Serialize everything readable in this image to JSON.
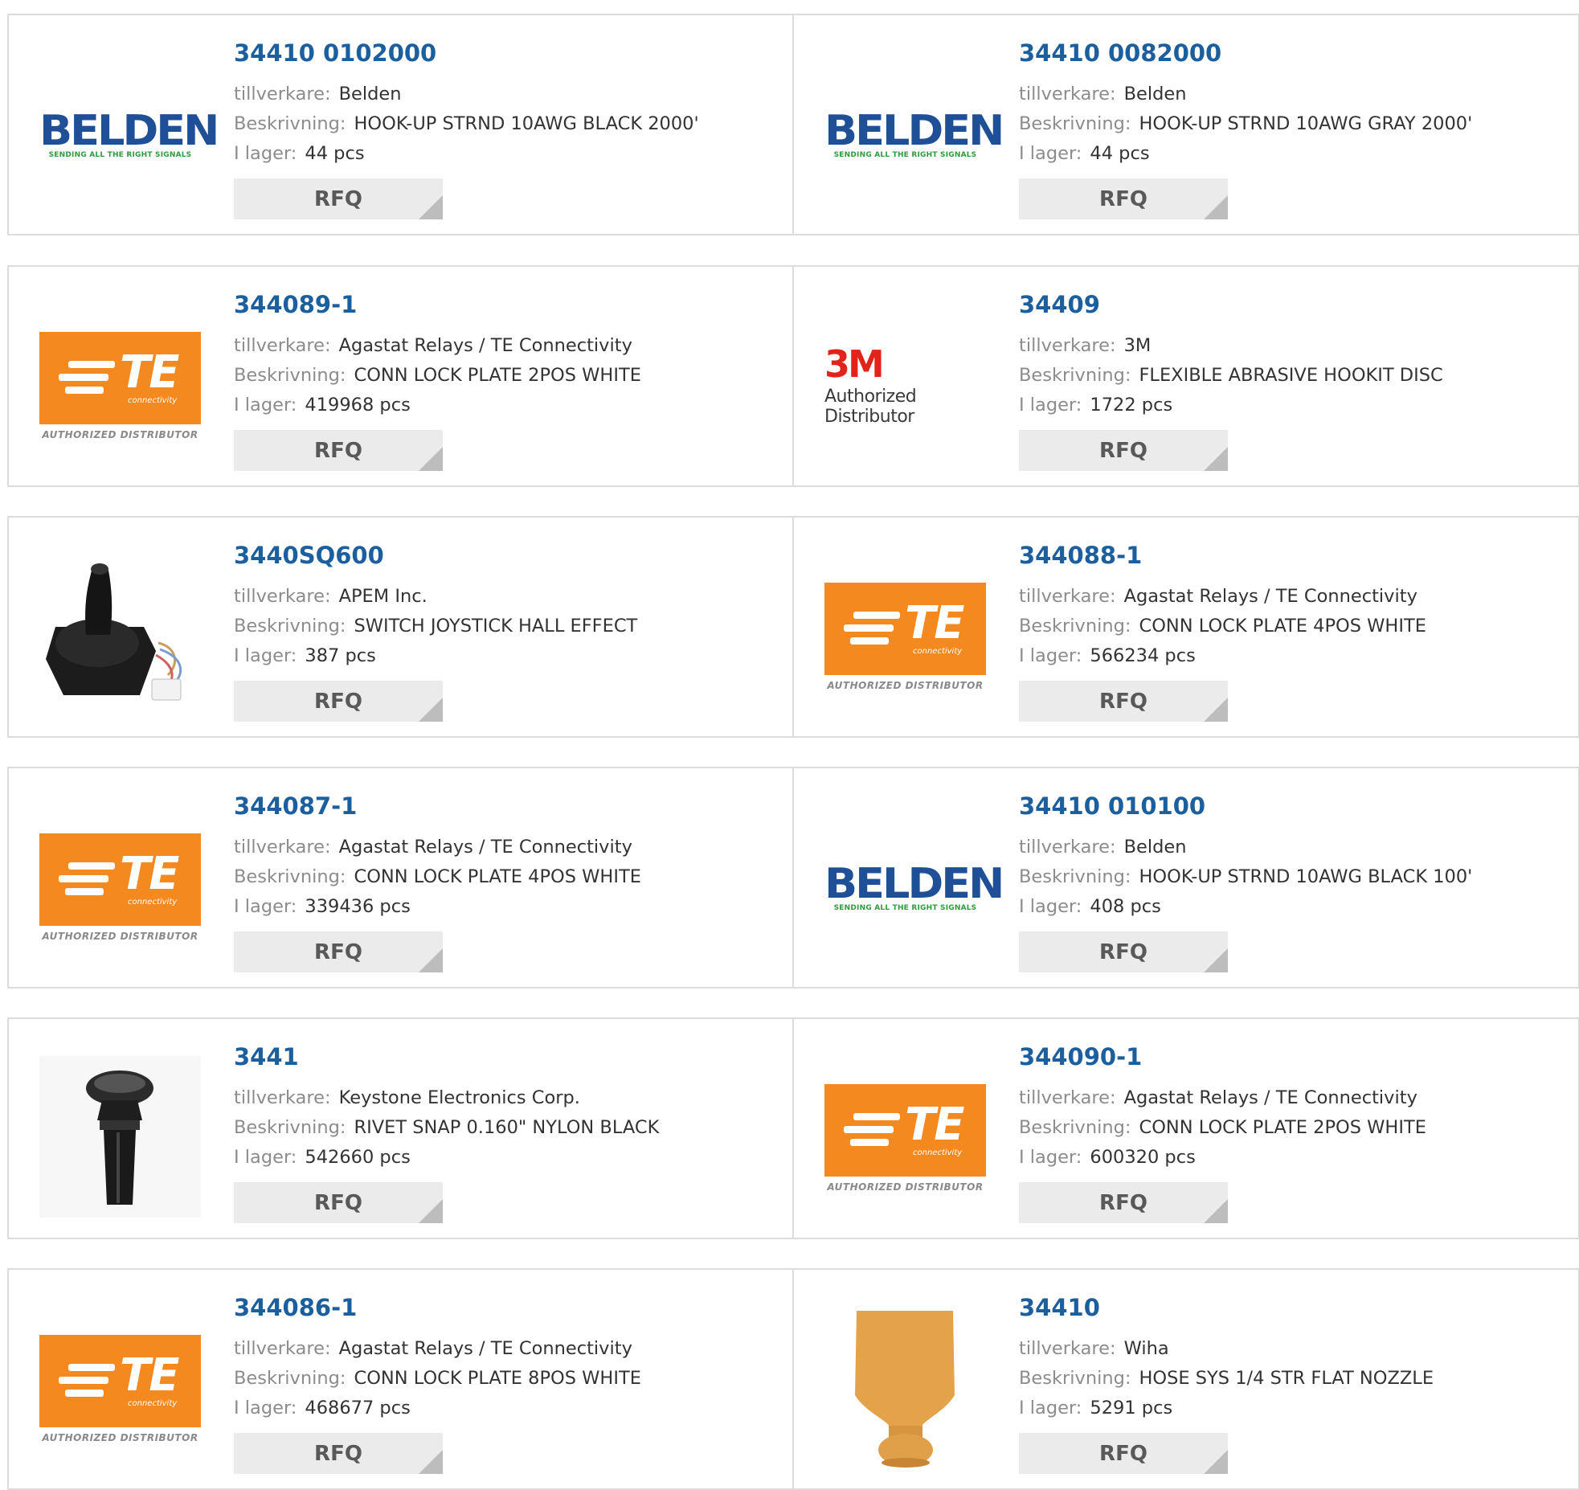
{
  "labels": {
    "manufacturer": "tillverkare:",
    "description": "Beskrivning:",
    "stock": "I lager:",
    "rfq": "RFQ"
  },
  "logo_text": {
    "belden_word": "BELDEN",
    "belden_tag": "SENDING ALL THE RIGHT SIGNALS",
    "te_letters": "TE",
    "te_sub": "connectivity",
    "te_auth": "AUTHORIZED DISTRIBUTOR",
    "mmm_logo": "3M",
    "mmm_auth": "Authorized Distributor"
  },
  "products": [
    {
      "part": "34410 0102000",
      "manufacturer": "Belden",
      "description": "HOOK-UP STRND 10AWG BLACK 2000'",
      "stock": "44 pcs",
      "image": "belden-logo"
    },
    {
      "part": "34410 0082000",
      "manufacturer": "Belden",
      "description": "HOOK-UP STRND 10AWG GRAY 2000'",
      "stock": "44 pcs",
      "image": "belden-logo"
    },
    {
      "part": "344089-1",
      "manufacturer": "Agastat Relays / TE Connectivity",
      "description": "CONN LOCK PLATE 2POS WHITE",
      "stock": "419968 pcs",
      "image": "te-logo"
    },
    {
      "part": "34409",
      "manufacturer": "3M",
      "description": "FLEXIBLE ABRASIVE HOOKIT DISC",
      "stock": "1722 pcs",
      "image": "3m-logo"
    },
    {
      "part": "3440SQ600",
      "manufacturer": "APEM Inc.",
      "description": "SWITCH JOYSTICK HALL EFFECT",
      "stock": "387 pcs",
      "image": "joystick-photo"
    },
    {
      "part": "344088-1",
      "manufacturer": "Agastat Relays / TE Connectivity",
      "description": "CONN LOCK PLATE 4POS WHITE",
      "stock": "566234 pcs",
      "image": "te-logo"
    },
    {
      "part": "344087-1",
      "manufacturer": "Agastat Relays / TE Connectivity",
      "description": "CONN LOCK PLATE 4POS WHITE",
      "stock": "339436 pcs",
      "image": "te-logo"
    },
    {
      "part": "34410 010100",
      "manufacturer": "Belden",
      "description": "HOOK-UP STRND 10AWG BLACK 100'",
      "stock": "408 pcs",
      "image": "belden-logo"
    },
    {
      "part": "3441",
      "manufacturer": "Keystone Electronics Corp.",
      "description": "RIVET SNAP 0.160\" NYLON BLACK",
      "stock": "542660 pcs",
      "image": "rivet-photo"
    },
    {
      "part": "344090-1",
      "manufacturer": "Agastat Relays / TE Connectivity",
      "description": "CONN LOCK PLATE 2POS WHITE",
      "stock": "600320 pcs",
      "image": "te-logo"
    },
    {
      "part": "344086-1",
      "manufacturer": "Agastat Relays / TE Connectivity",
      "description": "CONN LOCK PLATE 8POS WHITE",
      "stock": "468677 pcs",
      "image": "te-logo"
    },
    {
      "part": "34410",
      "manufacturer": "Wiha",
      "description": "HOSE SYS 1/4 STR FLAT NOZZLE",
      "stock": "5291 pcs",
      "image": "nozzle-photo"
    }
  ],
  "colors": {
    "part_link": "#1c5f9e",
    "border": "#dcdcdc",
    "rfq_bg": "#ebebeb",
    "te_orange": "#f48a1f",
    "belden_blue": "#1f4f97",
    "belden_green": "#2e9c3e",
    "mmm_red": "#e2231a"
  }
}
